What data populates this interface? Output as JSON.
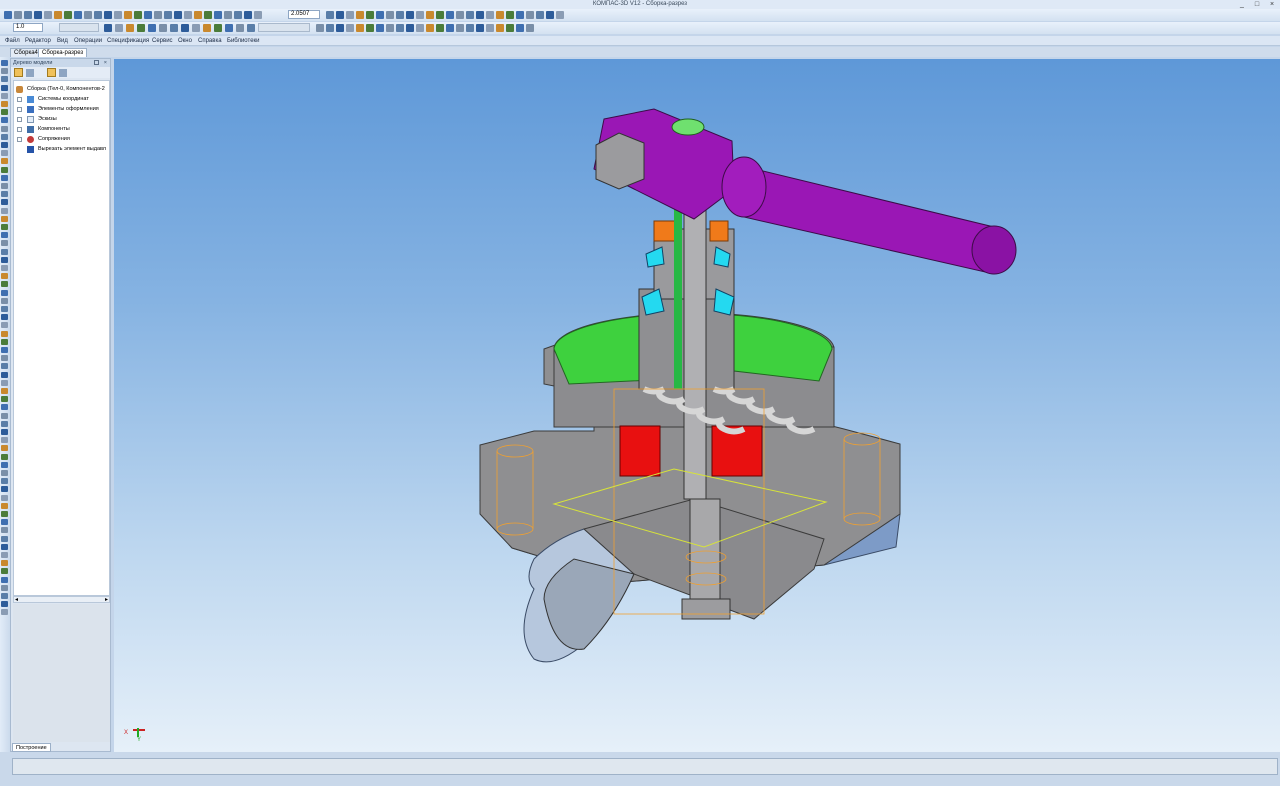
{
  "window": {
    "title": "КОМПАС-3D V12 - Сборка-разрез",
    "controls": {
      "minimize": "_",
      "maximize": "□",
      "close": "×"
    }
  },
  "toolbar": {
    "zoom_value": "2.0507",
    "line_scale": "1.0"
  },
  "menu": [
    "Файл",
    "Редактор",
    "Вид",
    "Операции",
    "Спецификация",
    "Сервис",
    "Окно",
    "Справка",
    "Библиотеки"
  ],
  "doc_tabs": [
    "Сборка4",
    "Сборка-разрез"
  ],
  "panel": {
    "title": "Дерево модели",
    "close": "×",
    "tree": [
      {
        "label": "Сборка (Тел-0, Компонентов-2",
        "icon": "assembly-icon"
      },
      {
        "label": "Системы координат",
        "icon": "coordinate-system-icon"
      },
      {
        "label": "Элементы оформления",
        "icon": "annotation-icon"
      },
      {
        "label": "Эскизы",
        "icon": "sketch-icon"
      },
      {
        "label": "Компоненты",
        "icon": "component-icon"
      },
      {
        "label": "Сопряжения",
        "icon": "mate-icon"
      },
      {
        "label": "Вырезать элемент выдавл",
        "icon": "extrude-cut-icon"
      }
    ],
    "bottom_tab": "Построение"
  },
  "axis": {
    "x": "X",
    "y": "Y"
  },
  "colors": {
    "viewport_top": "#5e98d8",
    "viewport_bottom": "#e6f0f9",
    "handle": "#9a17b5",
    "seal_red": "#e81010",
    "flange_green": "#3ed13e",
    "body_grey": "#8e8e8e"
  }
}
